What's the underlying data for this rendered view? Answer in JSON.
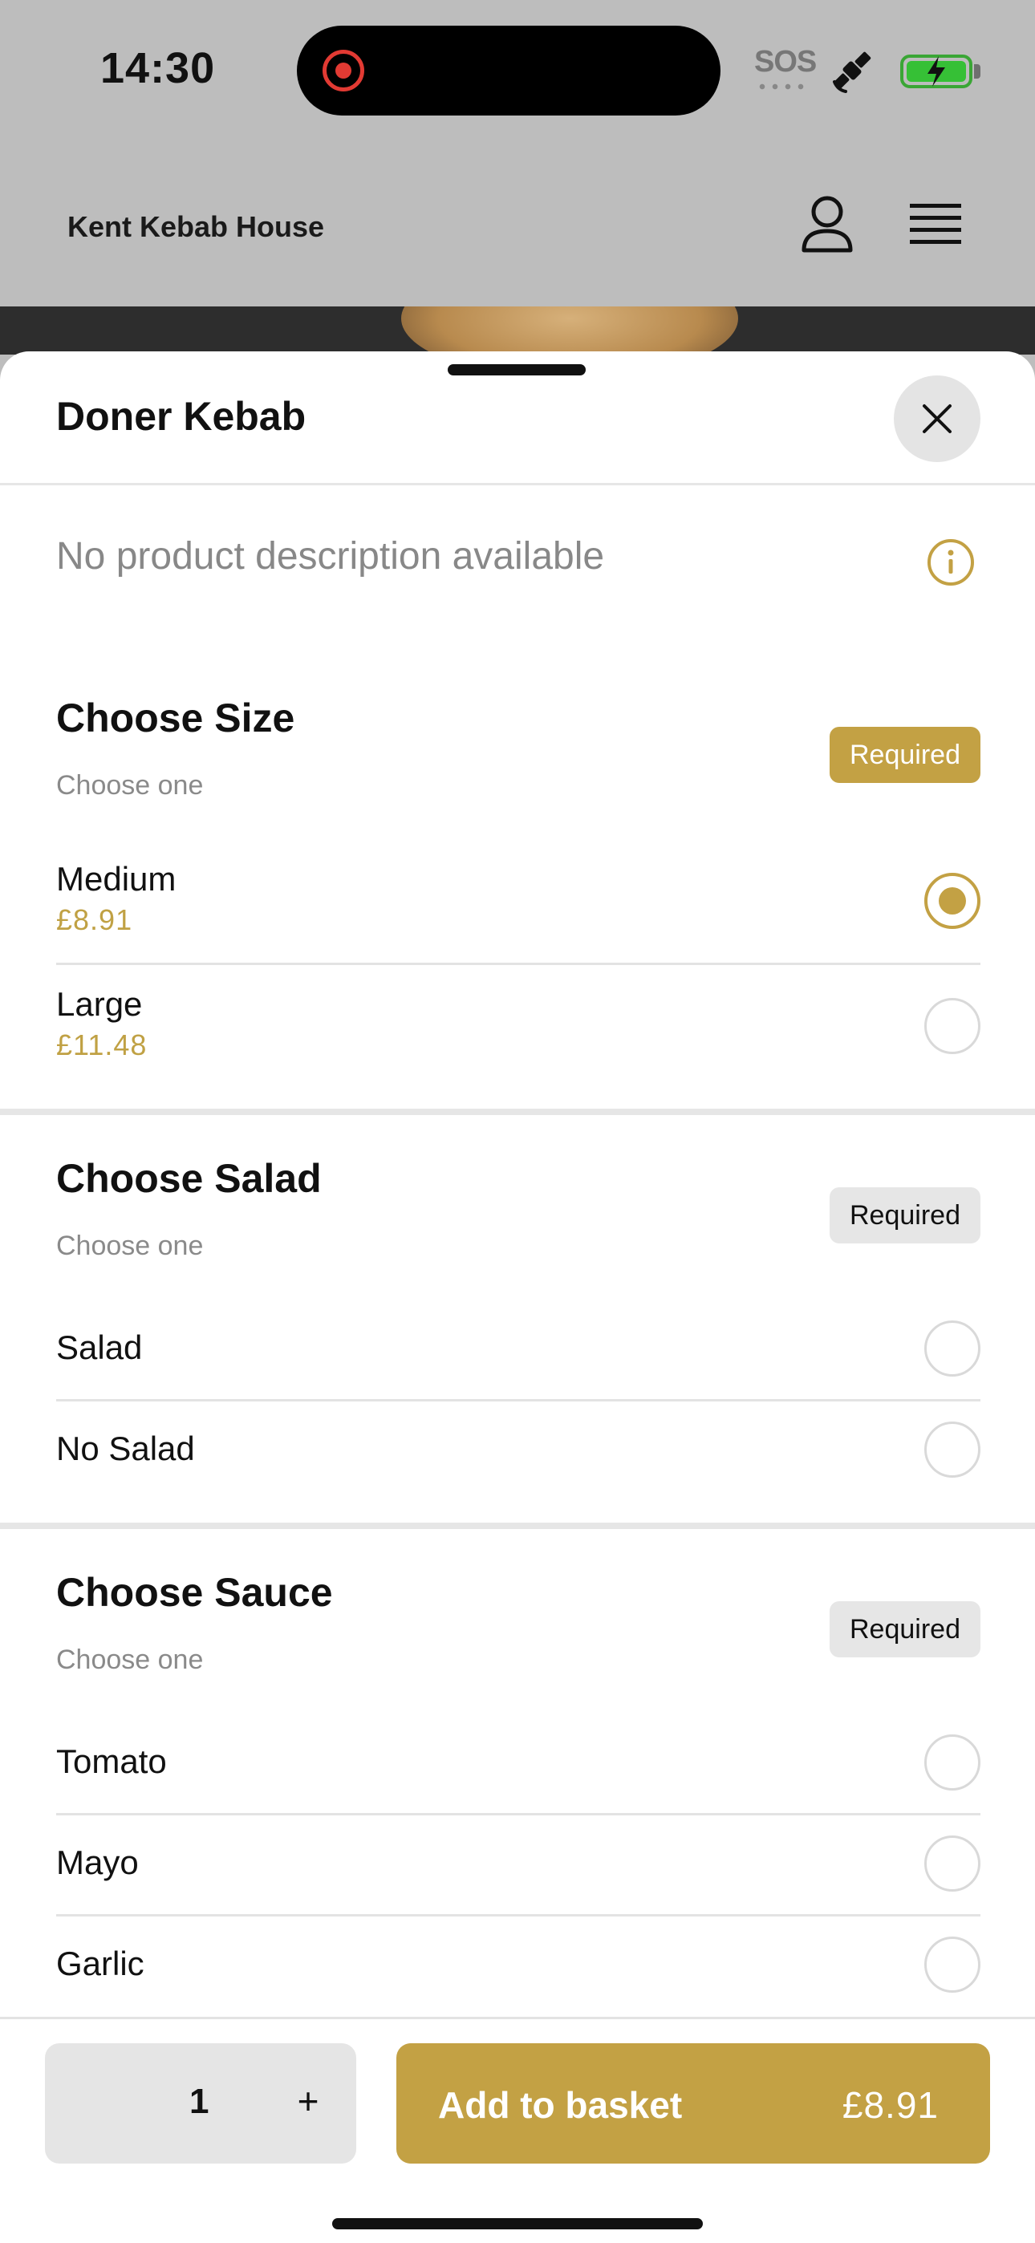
{
  "status_bar": {
    "time": "14:30",
    "sos": "SOS",
    "icons": [
      "screen-recording-icon",
      "satellite-icon",
      "battery-charging-icon"
    ]
  },
  "header": {
    "brand": "Kent Kebab House",
    "icons": [
      "user-icon",
      "menu-icon"
    ]
  },
  "product": {
    "title": "Doner Kebab",
    "description": "No product description available"
  },
  "sections": [
    {
      "title": "Choose Size",
      "subtitle": "Choose one",
      "badge": "Required",
      "options": [
        {
          "name": "Medium",
          "price": "£8.91",
          "selected": true
        },
        {
          "name": "Large",
          "price": "£11.48",
          "selected": false
        }
      ]
    },
    {
      "title": "Choose Salad",
      "subtitle": "Choose one",
      "badge": "Required",
      "options": [
        {
          "name": "Salad",
          "selected": false
        },
        {
          "name": "No Salad",
          "selected": false
        }
      ]
    },
    {
      "title": "Choose Sauce",
      "subtitle": "Choose one",
      "badge": "Required",
      "options": [
        {
          "name": "Tomato",
          "selected": false
        },
        {
          "name": "Mayo",
          "selected": false
        },
        {
          "name": "Garlic",
          "selected": false
        }
      ]
    }
  ],
  "footer": {
    "quantity": "1",
    "plus": "+",
    "add_label": "Add to basket",
    "total": "£8.91"
  },
  "colors": {
    "accent": "#c3a144",
    "sheet_bg": "#ffffff",
    "header_bg": "#bdbdbd",
    "badge_grey": "#e6e6e6"
  }
}
